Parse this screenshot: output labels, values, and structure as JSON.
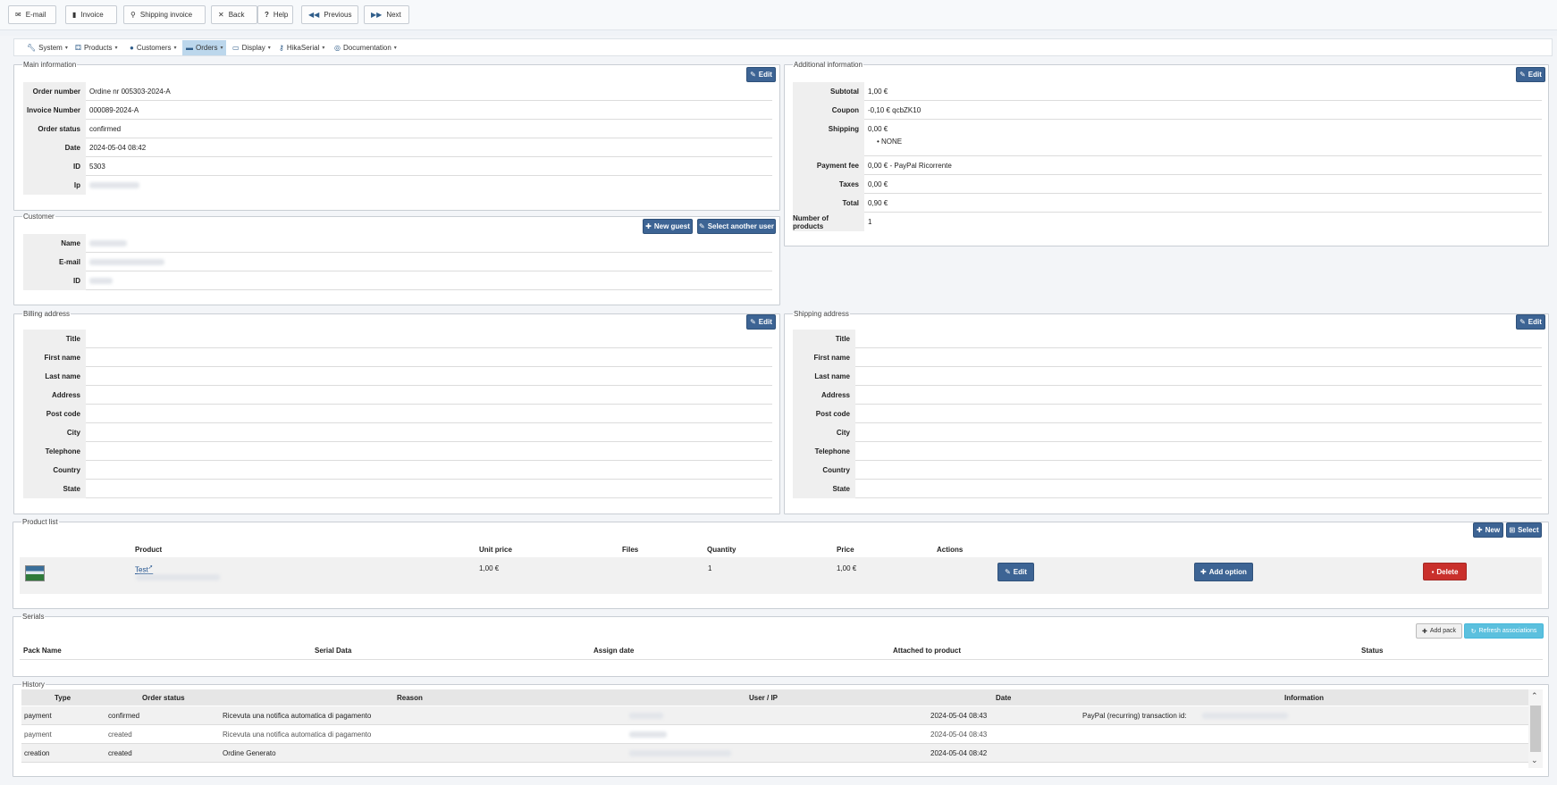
{
  "toolbar": {
    "email": "E-mail",
    "invoice": "Invoice",
    "shipping_invoice": "Shipping invoice",
    "back": "Back",
    "help": "Help",
    "previous": "Previous",
    "next": "Next"
  },
  "menu": {
    "system": "System",
    "products": "Products",
    "customers": "Customers",
    "orders": "Orders",
    "display": "Display",
    "hikaserial": "HikaSerial",
    "documentation": "Documentation"
  },
  "main_info": {
    "legend": "Main information",
    "edit": "Edit",
    "rows": [
      {
        "label": "Order number",
        "value": "Ordine nr 005303-2024-A"
      },
      {
        "label": "Invoice Number",
        "value": "000089-2024-A"
      },
      {
        "label": "Order status",
        "value": "confirmed"
      },
      {
        "label": "Date",
        "value": "2024-05-04 08:42"
      },
      {
        "label": "ID",
        "value": "5303"
      },
      {
        "label": "Ip",
        "value": ""
      }
    ]
  },
  "additional_info": {
    "legend": "Additional information",
    "edit": "Edit",
    "subtotal_label": "Subtotal",
    "subtotal": "1,00 €",
    "coupon_label": "Coupon",
    "coupon": "-0,10 € qcbZK10",
    "shipping_label": "Shipping",
    "shipping": "0,00 €",
    "shipping_method": "NONE",
    "payment_fee_label": "Payment fee",
    "payment_fee": "0,00 € - PayPal Ricorrente",
    "taxes_label": "Taxes",
    "taxes": "0,00 €",
    "total_label": "Total",
    "total": "0,90 €",
    "num_products_label": "Number of products",
    "num_products": "1"
  },
  "customer": {
    "legend": "Customer",
    "new_guest": "New guest",
    "select_user": "Select another user",
    "rows": [
      {
        "label": "Name",
        "value": ""
      },
      {
        "label": "E-mail",
        "value": ""
      },
      {
        "label": "ID",
        "value": ""
      }
    ]
  },
  "billing": {
    "legend": "Billing address",
    "edit": "Edit",
    "labels": [
      "Title",
      "First name",
      "Last name",
      "Address",
      "Post code",
      "City",
      "Telephone",
      "Country",
      "State"
    ]
  },
  "shipping_addr": {
    "legend": "Shipping address",
    "edit": "Edit",
    "labels": [
      "Title",
      "First name",
      "Last name",
      "Address",
      "Post code",
      "City",
      "Telephone",
      "Country",
      "State"
    ]
  },
  "product_list": {
    "legend": "Product list",
    "new": "New",
    "select": "Select",
    "headers": {
      "product": "Product",
      "unit_price": "Unit price",
      "files": "Files",
      "quantity": "Quantity",
      "price": "Price",
      "actions": "Actions"
    },
    "item": {
      "name": "Test",
      "unit_price": "1,00 €",
      "quantity": "1",
      "price": "1,00 €"
    },
    "edit": "Edit",
    "add_option": "Add option",
    "delete": "Delete"
  },
  "serials": {
    "legend": "Serials",
    "add_pack": "Add pack",
    "refresh": "Refresh associations",
    "headers": {
      "pack_name": "Pack Name",
      "serial_data": "Serial Data",
      "assign_date": "Assign date",
      "attached": "Attached to product",
      "status": "Status"
    }
  },
  "history": {
    "legend": "History",
    "headers": {
      "type": "Type",
      "order_status": "Order status",
      "reason": "Reason",
      "user_ip": "User / IP",
      "date": "Date",
      "information": "Information"
    },
    "rows": [
      {
        "type": "payment",
        "status": "confirmed",
        "reason": "Ricevuta una notifica automatica di pagamento",
        "date": "2024-05-04 08:43",
        "information": "PayPal (recurring) transaction id:"
      },
      {
        "type": "payment",
        "status": "created",
        "reason": "Ricevuta una notifica automatica di pagamento",
        "date": "2024-05-04 08:43",
        "information": ""
      },
      {
        "type": "creation",
        "status": "created",
        "reason": "Ordine Generato",
        "date": "2024-05-04 08:42",
        "information": ""
      }
    ]
  }
}
